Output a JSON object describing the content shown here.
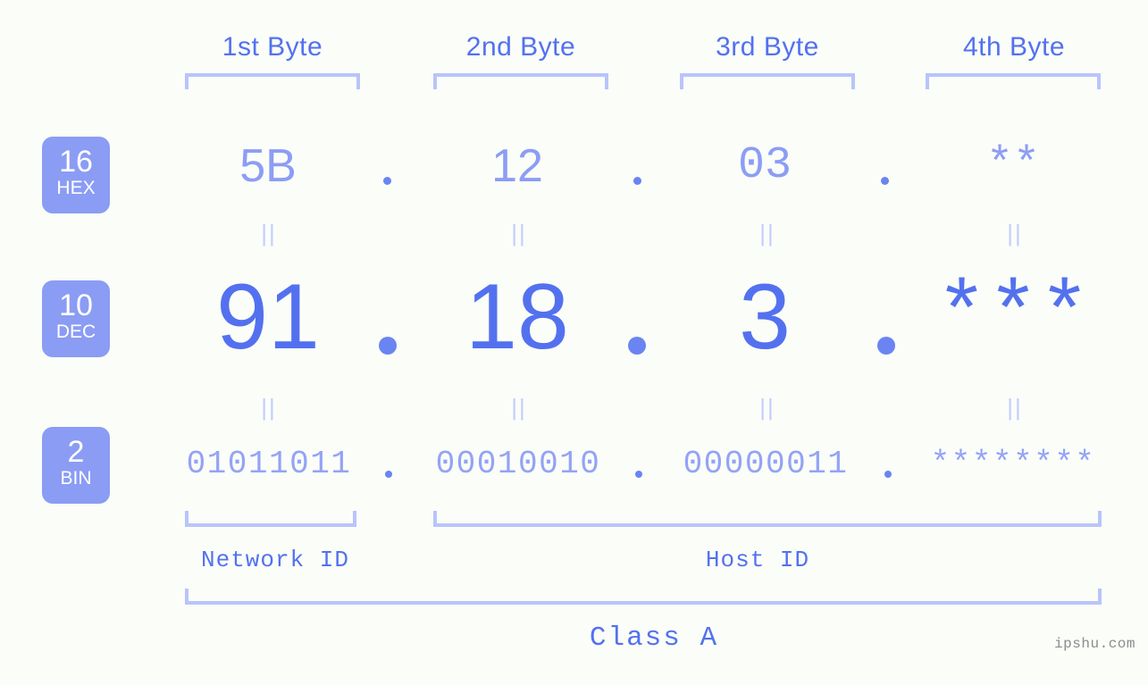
{
  "meta": {
    "watermark": "ipshu.com",
    "accent_strong": "#5371ef",
    "accent_mid": "#8c9df5",
    "accent_light": "#b9c4fb",
    "background": "#fbfdf9"
  },
  "byte_headers": [
    {
      "label": "1st Byte"
    },
    {
      "label": "2nd Byte"
    },
    {
      "label": "3rd Byte"
    },
    {
      "label": "4th Byte"
    }
  ],
  "radix_badges": [
    {
      "number": "16",
      "name": "HEX"
    },
    {
      "number": "10",
      "name": "DEC"
    },
    {
      "number": "2",
      "name": "BIN"
    }
  ],
  "rows": {
    "hex": {
      "radix": "16",
      "values": [
        "5B",
        "12",
        "03",
        "**"
      ],
      "separators": [
        ".",
        ".",
        "."
      ]
    },
    "dec": {
      "radix": "10",
      "values": [
        "91",
        "18",
        "3",
        "***"
      ],
      "separators": [
        ".",
        ".",
        "."
      ]
    },
    "bin": {
      "radix": "2",
      "values": [
        "01011011",
        "00010010",
        "00000011",
        "********"
      ],
      "separators": [
        ".",
        ".",
        "."
      ]
    }
  },
  "equality_marks": {
    "hex_to_dec": [
      "||",
      "||",
      "||",
      "||"
    ],
    "dec_to_bin": [
      "||",
      "||",
      "||",
      "||"
    ]
  },
  "id_labels": [
    {
      "label": "Network ID"
    },
    {
      "label": "Host ID"
    }
  ],
  "class_label": "Class A"
}
